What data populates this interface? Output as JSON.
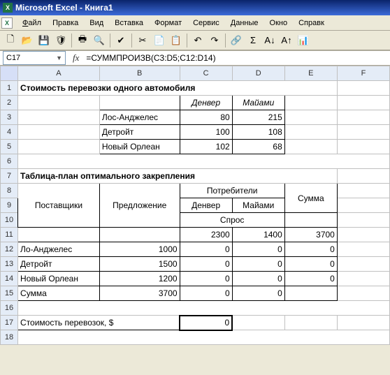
{
  "window": {
    "title": "Microsoft Excel - Книга1"
  },
  "menu": {
    "file": "Файл",
    "edit": "Правка",
    "view": "Вид",
    "insert": "Вставка",
    "format": "Формат",
    "tools": "Сервис",
    "data": "Данные",
    "window": "Окно",
    "help": "Справк"
  },
  "icons": {
    "new": "🗋",
    "open": "📂",
    "save": "💾",
    "perm": "🛡",
    "print": "🖶",
    "preview": "🔍",
    "spell": "✔",
    "cut": "✂",
    "copy": "📄",
    "paste": "📋",
    "undo": "↶",
    "redo": "↷",
    "link": "🔗",
    "sum": "Σ",
    "sortAZ": "A↓",
    "sortZA": "A↑",
    "chart": "📊"
  },
  "formula_bar": {
    "name_box": "C17",
    "fx": "fx",
    "formula": "=СУММПРОИЗВ(C3:D5;C12:D14)"
  },
  "columns": [
    "A",
    "B",
    "C",
    "D",
    "E",
    "F"
  ],
  "rows": [
    "1",
    "2",
    "3",
    "4",
    "5",
    "6",
    "7",
    "8",
    "9",
    "10",
    "11",
    "12",
    "13",
    "14",
    "15",
    "16",
    "17",
    "18"
  ],
  "sheet": {
    "title1": "Стоимость перевозки одного автомобиля",
    "t1": {
      "colC": "Денвер",
      "colD": "Майами",
      "r3B": "Лос-Анджелес",
      "r3C": "80",
      "r3D": "215",
      "r4B": "Детройт",
      "r4C": "100",
      "r4D": "108",
      "r5B": "Новый Орлеан",
      "r5C": "102",
      "r5D": "68"
    },
    "title2": "Таблица-план оптимального закрепления",
    "t2": {
      "suppliers": "Поставщики",
      "offer": "Предложение",
      "consumers": "Потребители",
      "sum": "Сумма",
      "denver": "Денвер",
      "miami": "Майами",
      "demand": "Спрос",
      "d_denver": "2300",
      "d_miami": "1400",
      "d_sum": "3700",
      "r12A": "Ло-Анджелес",
      "r12B": "1000",
      "r12C": "0",
      "r12D": "0",
      "r12E": "0",
      "r13A": "Детройт",
      "r13B": "1500",
      "r13C": "0",
      "r13D": "0",
      "r13E": "0",
      "r14A": "Новый Орлеан",
      "r14B": "1200",
      "r14C": "0",
      "r14D": "0",
      "r14E": "0",
      "r15A": "Сумма",
      "r15B": "3700",
      "r15C": "0",
      "r15D": "0"
    },
    "cost_label": "Стоимость перевозок, $",
    "cost_value": "0"
  },
  "chart_data": [
    {
      "type": "table",
      "title": "Стоимость перевозки одного автомобиля",
      "columns": [
        "",
        "Денвер",
        "Майами"
      ],
      "rows": [
        [
          "Лос-Анджелес",
          80,
          215
        ],
        [
          "Детройт",
          100,
          108
        ],
        [
          "Новый Орлеан",
          102,
          68
        ]
      ]
    },
    {
      "type": "table",
      "title": "Таблица-план оптимального закрепления",
      "columns": [
        "Поставщики",
        "Предложение",
        "Денвер",
        "Майами",
        "Сумма"
      ],
      "demand": {
        "Денвер": 2300,
        "Майами": 1400,
        "Сумма": 3700
      },
      "rows": [
        [
          "Ло-Анджелес",
          1000,
          0,
          0,
          0
        ],
        [
          "Детройт",
          1500,
          0,
          0,
          0
        ],
        [
          "Новый Орлеан",
          1200,
          0,
          0,
          0
        ],
        [
          "Сумма",
          3700,
          0,
          0,
          null
        ]
      ],
      "result": {
        "label": "Стоимость перевозок, $",
        "value": 0
      }
    }
  ]
}
